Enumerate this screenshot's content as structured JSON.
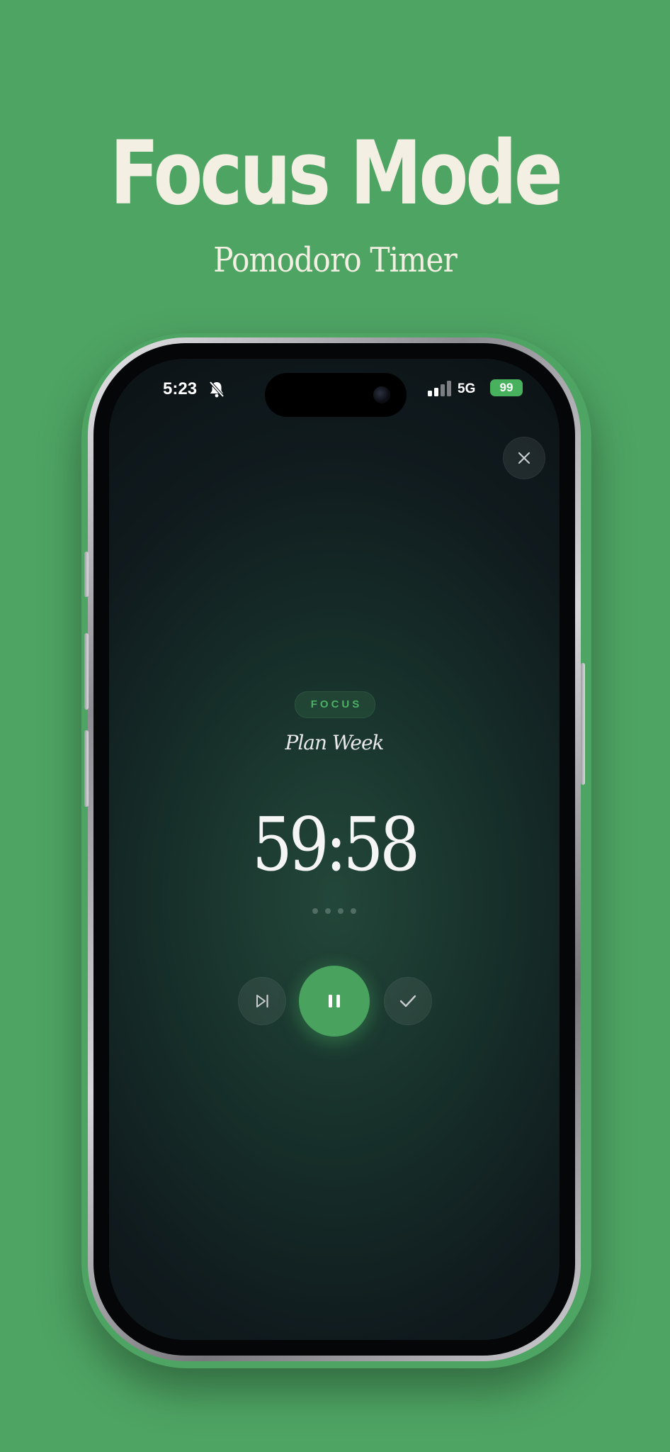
{
  "promo": {
    "headline": "Focus Mode",
    "subhead": "Pomodoro Timer",
    "background_color": "#4ea463"
  },
  "status_bar": {
    "time": "5:23",
    "network": "5G",
    "battery": "99",
    "icons": [
      "bell-muted-icon",
      "signal-icon",
      "battery-charging-icon"
    ]
  },
  "timer_screen": {
    "mode_label": "FOCUS",
    "task_name": "Plan Week",
    "time_remaining": "59:58",
    "session_dots": 4,
    "accent_color": "#49a35f",
    "controls": {
      "close": "close-icon",
      "skip": "skip-forward-icon",
      "pause": "pause-icon",
      "complete": "checkmark-icon"
    }
  }
}
